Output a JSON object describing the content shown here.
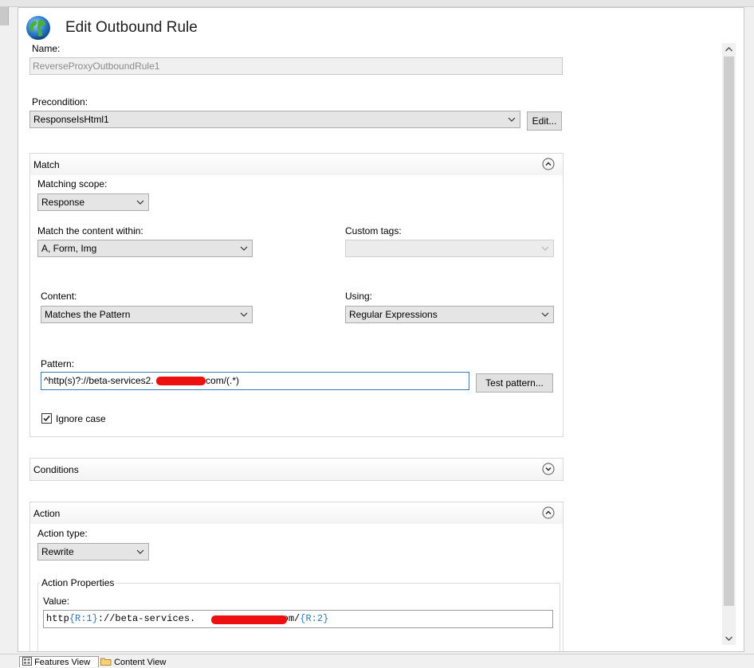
{
  "window": {
    "title": "Edit Outbound Rule"
  },
  "name": {
    "label": "Name:",
    "value": "ReverseProxyOutboundRule1"
  },
  "precondition": {
    "label": "Precondition:",
    "value": "ResponseIsHtml1",
    "edit_label": "Edit..."
  },
  "match": {
    "header": "Match",
    "scope_label": "Matching scope:",
    "scope_value": "Response",
    "within_label": "Match the content within:",
    "within_value": "A, Form, Img",
    "custom_tags_label": "Custom tags:",
    "custom_tags_value": "",
    "content_label": "Content:",
    "content_value": "Matches the Pattern",
    "using_label": "Using:",
    "using_value": "Regular Expressions",
    "pattern_label": "Pattern:",
    "pattern_prefix": "^http(s)?://beta-services2.",
    "pattern_suffix": ".com/(.*)",
    "test_label": "Test pattern...",
    "ignore_case_label": "Ignore case",
    "ignore_case_checked": true
  },
  "conditions": {
    "header": "Conditions"
  },
  "action": {
    "header": "Action",
    "type_label": "Action type:",
    "type_value": "Rewrite",
    "props_label": "Action Properties",
    "value_label": "Value:",
    "value_p1": "http",
    "value_p2": "{R:1}",
    "value_p3": "://beta-services.",
    "value_p4": ".com/",
    "value_p5": "{R:2}"
  },
  "tabs": {
    "features": "Features View",
    "content": "Content View"
  },
  "icons": [
    "globe-icon",
    "chevron-down-icon",
    "collapse-up-icon",
    "expand-down-icon",
    "checkmark-icon",
    "scroll-up-icon",
    "scroll-down-icon",
    "features-view-icon",
    "content-view-icon"
  ],
  "colors": {
    "redaction": "#ee1010",
    "focus_border": "#2f7fc1",
    "server_variable": "#3573b5"
  }
}
